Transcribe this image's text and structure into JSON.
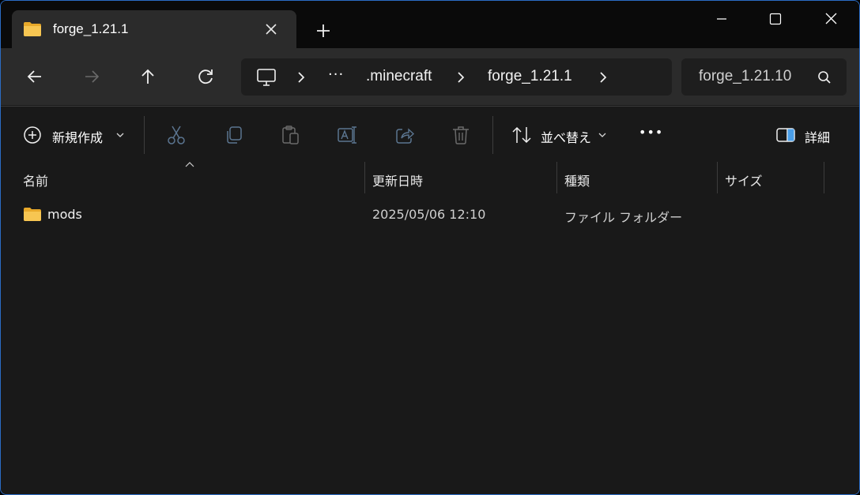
{
  "window": {
    "tab_title": "forge_1.21.1",
    "accent_border": "#2b6cc4",
    "folder_color": "#f4c04a"
  },
  "titlebar_icons": [
    "folder-icon",
    "close-tab-icon",
    "plus-icon",
    "minimize-icon",
    "maximize-icon",
    "close-icon"
  ],
  "navigation": {
    "icons": [
      "back-arrow-icon",
      "forward-arrow-icon",
      "up-arrow-icon",
      "refresh-icon"
    ],
    "breadcrumb": {
      "overflow": "···",
      "items": [
        ".minecraft",
        "forge_1.21.1"
      ]
    },
    "search_value": "forge_1.21.10"
  },
  "command_bar": {
    "new_label": "新規作成",
    "sort_label": "並べ替え",
    "details_label": "詳細",
    "more_label": "•••",
    "icons": [
      "add-circle-icon",
      "cut-icon",
      "copy-icon",
      "paste-icon",
      "rename-icon",
      "share-icon",
      "delete-icon",
      "sort-icon",
      "details-pane-icon"
    ]
  },
  "columns": {
    "name": "名前",
    "modified": "更新日時",
    "type": "種類",
    "size": "サイズ"
  },
  "files": [
    {
      "name": "mods",
      "modified": "2025/05/06 12:10",
      "type": "ファイル フォルダー",
      "size": ""
    }
  ]
}
